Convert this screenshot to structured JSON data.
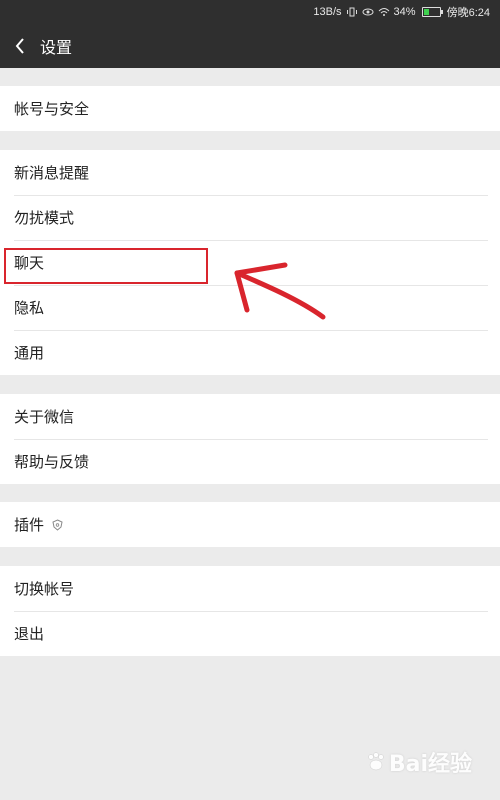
{
  "status_bar": {
    "speed": "13B/s",
    "battery_percent": "34%",
    "time": "傍晚6:24"
  },
  "header": {
    "title": "设置"
  },
  "groups": [
    {
      "items": [
        "帐号与安全"
      ]
    },
    {
      "items": [
        "新消息提醒",
        "勿扰模式",
        "聊天",
        "隐私",
        "通用"
      ]
    },
    {
      "items": [
        "关于微信",
        "帮助与反馈"
      ]
    },
    {
      "items": [
        "插件"
      ]
    },
    {
      "items": [
        "切换帐号",
        "退出"
      ]
    }
  ],
  "watermark": {
    "text": "Bai经验"
  },
  "colors": {
    "header_bg": "#2f2f2f",
    "page_bg": "#ebebeb",
    "annotation": "#d9252d"
  }
}
